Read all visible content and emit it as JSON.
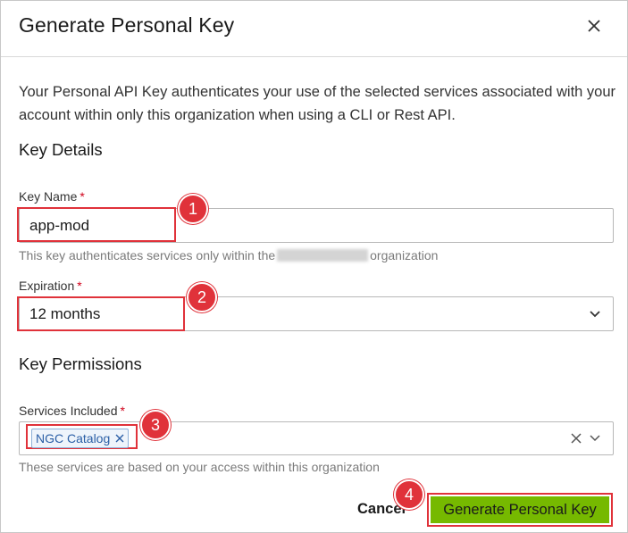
{
  "dialog": {
    "title": "Generate Personal Key",
    "description": "Your Personal API Key authenticates your use of the selected services associated with your account within only this organization when using a CLI or Rest API."
  },
  "key_details": {
    "heading": "Key Details",
    "key_name": {
      "label": "Key Name",
      "required_mark": "*",
      "value": "app-mod",
      "helper_before": "This key authenticates services only within the",
      "helper_after": "organization"
    },
    "expiration": {
      "label": "Expiration",
      "required_mark": "*",
      "selected": "12 months"
    }
  },
  "key_permissions": {
    "heading": "Key Permissions",
    "services": {
      "label": "Services Included",
      "required_mark": "*",
      "chips": [
        "NGC Catalog"
      ],
      "helper": "These services are based on your access within this organization"
    }
  },
  "footer": {
    "cancel_label": "Cancel",
    "generate_label": "Generate Personal Key"
  },
  "annotations": [
    "1",
    "2",
    "3",
    "4"
  ],
  "colors": {
    "primary_button": "#76b900",
    "annotation_red": "#e0323a",
    "chip_text": "#2b5fa6",
    "required": "#d0021b"
  },
  "icons": {
    "close": "close-icon",
    "dropdown": "chevron-down-icon",
    "clear": "clear-icon",
    "chip_remove": "chip-remove-icon"
  }
}
